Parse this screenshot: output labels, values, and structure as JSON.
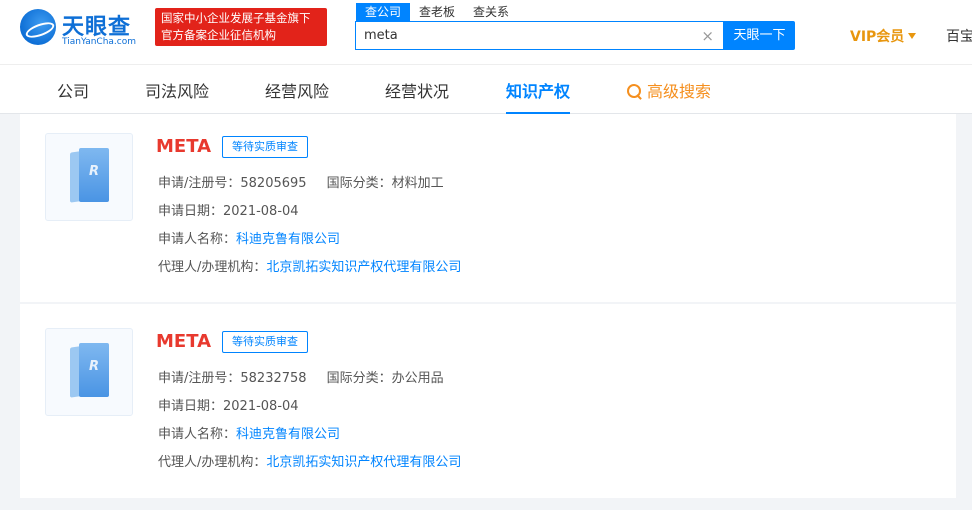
{
  "header": {
    "logo_cn": "天眼查",
    "logo_en": "TianYanCha.com",
    "promo_lines": [
      "国家中小企业发展子基金旗下",
      "官方备案企业征信机构"
    ],
    "search_tabs": [
      "查公司",
      "查老板",
      "查关系"
    ],
    "search_value": "meta",
    "clear_symbol": "×",
    "search_button": "天眼一下",
    "vip_label": "VIP会员",
    "right_item": "百宝"
  },
  "nav": {
    "items": [
      "公司",
      "司法风险",
      "经营风险",
      "经营状况",
      "知识产权"
    ],
    "active": "知识产权",
    "advanced": "高级搜索"
  },
  "labels": {
    "reg_no": "申请/注册号：",
    "intl_class": "国际分类：",
    "apply_date": "申请日期：",
    "applicant": "申请人名称：",
    "agency": "代理人/办理机构："
  },
  "results": [
    {
      "mark": "META",
      "status": "等待实质审查",
      "reg_no": "58205695",
      "intl_class": "材料加工",
      "apply_date": "2021-08-04",
      "applicant": "科迪克鲁有限公司",
      "agency": "北京凯拓实知识产权代理有限公司"
    },
    {
      "mark": "META",
      "status": "等待实质审查",
      "reg_no": "58232758",
      "intl_class": "办公用品",
      "apply_date": "2021-08-04",
      "applicant": "科迪克鲁有限公司",
      "agency": "北京凯拓实知识产权代理有限公司"
    }
  ],
  "colors": {
    "accent": "#0084ff",
    "brand_red": "#e2231a",
    "mark_red": "#e8392e",
    "vip_gold": "#e8960e",
    "advanced_orange": "#f58f1e"
  }
}
